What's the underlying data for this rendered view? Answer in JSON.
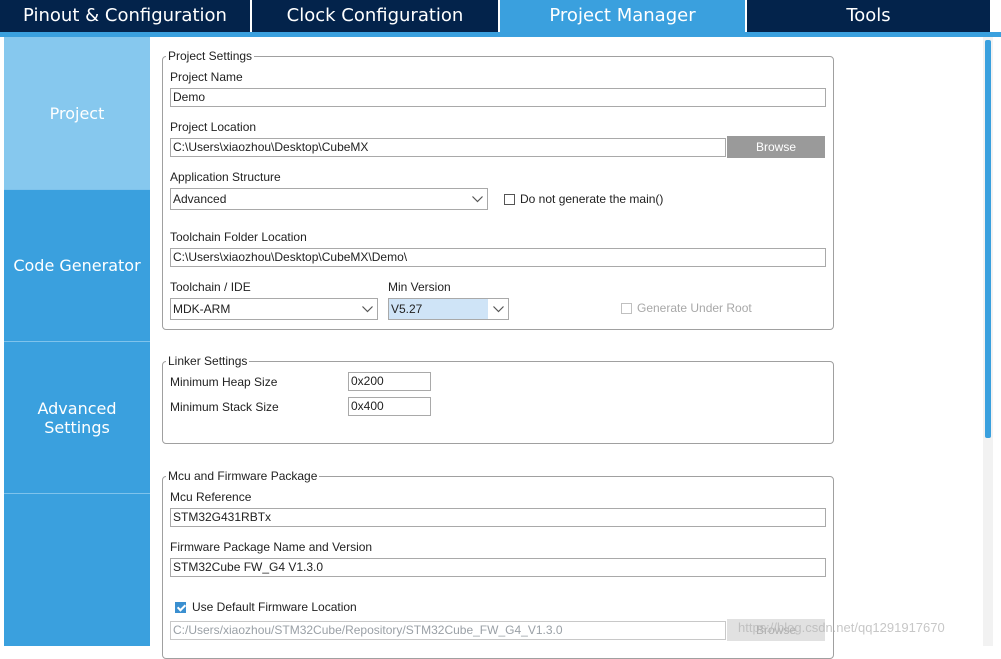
{
  "tabs": [
    {
      "label": "Pinout & Configuration"
    },
    {
      "label": "Clock Configuration"
    },
    {
      "label": "Project Manager"
    },
    {
      "label": "Tools"
    }
  ],
  "sidebar": {
    "items": [
      {
        "label": "Project"
      },
      {
        "label": "Code Generator"
      },
      {
        "label": "Advanced Settings"
      }
    ]
  },
  "project_settings": {
    "legend": "Project Settings",
    "project_name_label": "Project Name",
    "project_name": "Demo",
    "project_location_label": "Project Location",
    "project_location": "C:\\Users\\xiaozhou\\Desktop\\CubeMX",
    "browse_label": "Browse",
    "app_structure_label": "Application Structure",
    "app_structure": "Advanced",
    "no_main_label": "Do not generate the main()",
    "toolchain_folder_label": "Toolchain Folder Location",
    "toolchain_folder": "C:\\Users\\xiaozhou\\Desktop\\CubeMX\\Demo\\",
    "toolchain_label": "Toolchain / IDE",
    "toolchain": "MDK-ARM",
    "min_version_label": "Min Version",
    "min_version": "V5.27",
    "generate_under_root_label": "Generate Under Root"
  },
  "linker_settings": {
    "legend": "Linker Settings",
    "heap_label": "Minimum Heap Size",
    "heap": "0x200",
    "stack_label": "Minimum Stack Size",
    "stack": "0x400"
  },
  "mcu": {
    "legend": "Mcu and Firmware Package",
    "mcu_ref_label": "Mcu Reference",
    "mcu_ref": "STM32G431RBTx",
    "fw_label": "Firmware Package Name and Version",
    "fw": "STM32Cube FW_G4 V1.3.0",
    "use_default_label": "Use Default Firmware Location",
    "fw_location": "C:/Users/xiaozhou/STM32Cube/Repository/STM32Cube_FW_G4_V1.3.0",
    "browse_label": "Browse"
  },
  "watermark": "https://blog.csdn.net/qq1291917670",
  "colors": {
    "tab_dark": "#03234b",
    "accent": "#3aa0de",
    "sidebar_active": "#86c8ee"
  },
  "icons": {
    "dropdown": "chevron-down-icon",
    "check": "checkmark-icon"
  }
}
